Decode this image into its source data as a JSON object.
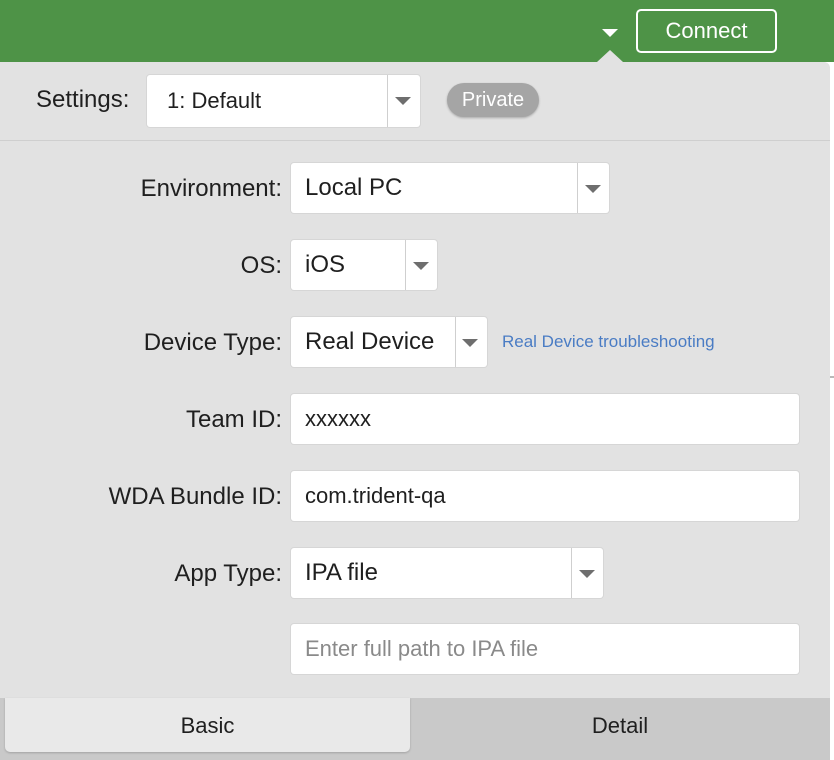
{
  "topbar": {
    "connect_label": "Connect",
    "dropdown_icon": "caret-down-icon",
    "color": "#4e9347"
  },
  "settings": {
    "label": "Settings:",
    "selected": "1: Default",
    "badge": "Private"
  },
  "form": {
    "environment": {
      "label": "Environment:",
      "selected": "Local PC"
    },
    "os": {
      "label": "OS:",
      "selected": "iOS"
    },
    "device_type": {
      "label": "Device Type:",
      "selected": "Real Device",
      "link": "Real Device troubleshooting"
    },
    "team_id": {
      "label": "Team ID:",
      "value": "xxxxxx"
    },
    "wda_bundle_id": {
      "label": "WDA Bundle ID:",
      "value": "com.trident-qa"
    },
    "app_type": {
      "label": "App Type:",
      "selected": "IPA file"
    },
    "app_path": {
      "value": "",
      "placeholder": "Enter full path to IPA file"
    }
  },
  "tabs": [
    {
      "label": "Basic",
      "active": true
    },
    {
      "label": "Detail",
      "active": false
    }
  ],
  "colors": {
    "accent_green": "#4e9347",
    "link_blue": "#4a7cc4",
    "panel_bg": "#e2e2e2"
  }
}
